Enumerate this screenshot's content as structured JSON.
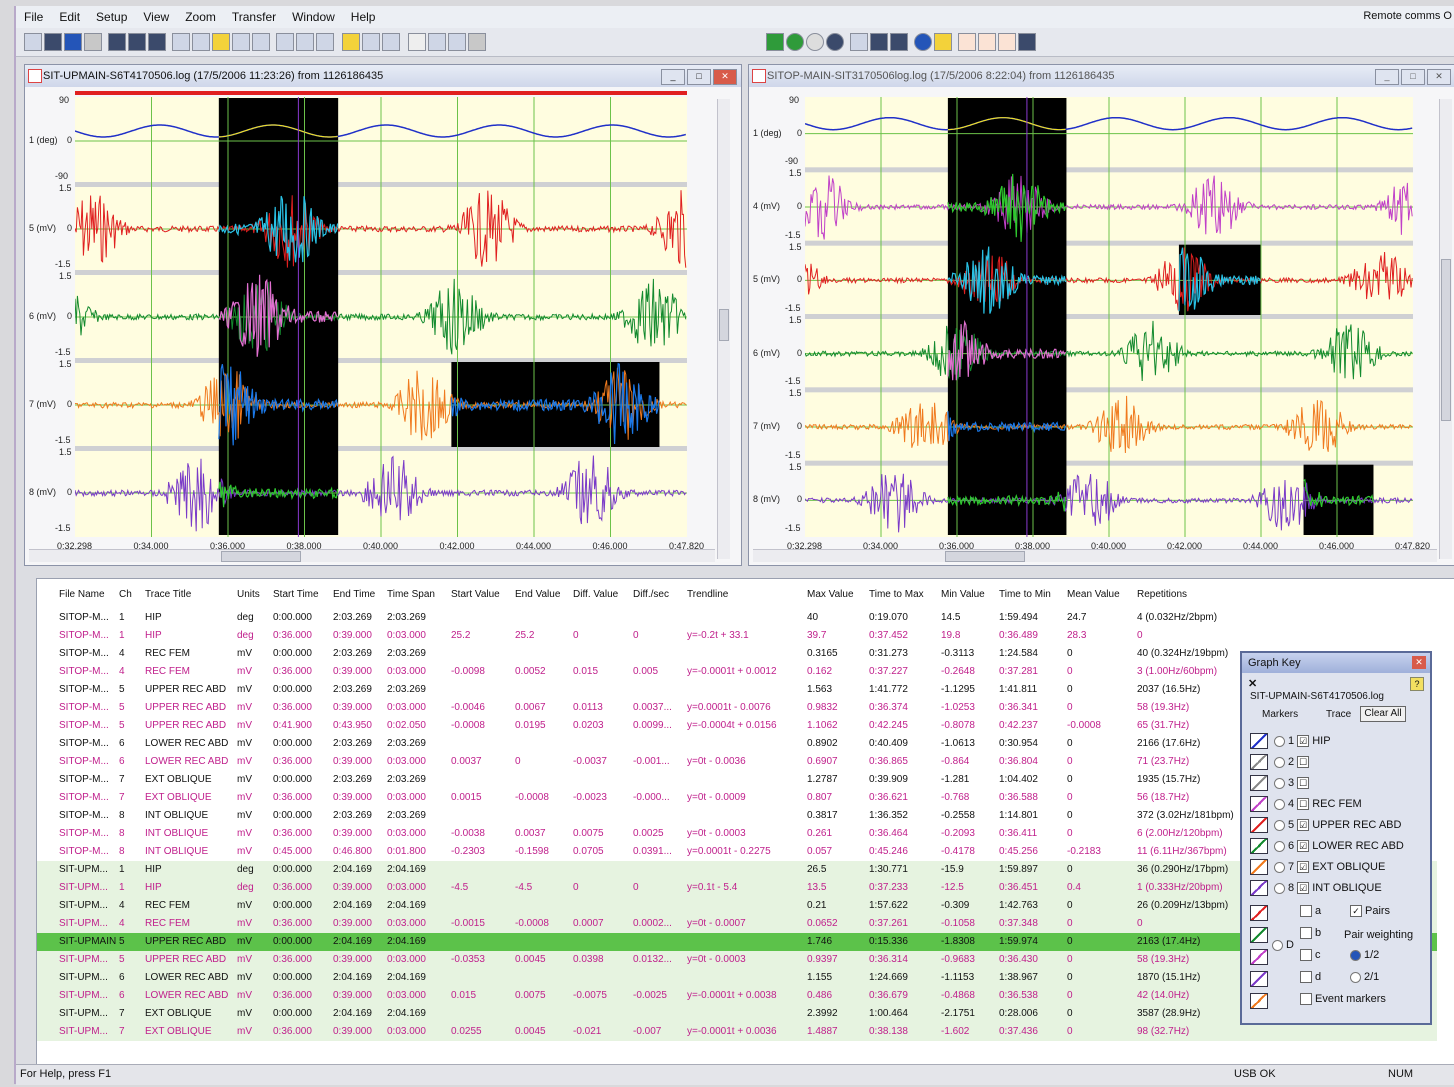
{
  "menu": {
    "items": [
      "File",
      "Edit",
      "Setup",
      "View",
      "Zoom",
      "Transfer",
      "Window",
      "Help"
    ],
    "remote_status": "Remote comms O"
  },
  "colors": {
    "trace1": "#2030c8",
    "trace5": "#e02020",
    "trace6": "#138a2e",
    "trace7": "#f07a1e",
    "trace8": "#7a3ac8",
    "trace4": "#c040c8",
    "highlight_cyan": "#29c2e6",
    "highlight_pink": "#e070d0",
    "highlight_blue": "#1a78e8",
    "highlight_green": "#2fc82f",
    "highlight_yellow": "#f0e020",
    "selected_row": "#5cc24a",
    "row_shade": "#e6f3e0",
    "magenta_text": "#c0208c"
  },
  "left_window": {
    "title": "SIT-UPMAIN-S6T4170506.log (17/5/2006 11:23:26) from 1126186435",
    "channels": [
      {
        "label": "1  (deg)",
        "top": "90",
        "zero": "0",
        "bottom": "-90"
      },
      {
        "label": "5  (mV)",
        "top": "1.5",
        "zero": "0",
        "bottom": "-1.5"
      },
      {
        "label": "6  (mV)",
        "top": "1.5",
        "zero": "0",
        "bottom": "-1.5"
      },
      {
        "label": "7  (mV)",
        "top": "1.5",
        "zero": "0",
        "bottom": "-1.5"
      },
      {
        "label": "8  (mV)",
        "top": "1.5",
        "zero": "0",
        "bottom": "-1.5"
      }
    ],
    "time_ticks": [
      "0:32.298",
      "0:34.000",
      "0:36.000",
      "0:38.000",
      "0:40.000",
      "0:42.000",
      "0:44.000",
      "0:46.000",
      "0:47.820"
    ]
  },
  "right_window": {
    "title": "SITOP-MAIN-SIT3170506log.log (17/5/2006 8:22:04) from 1126186435",
    "channels": [
      {
        "label": "1  (deg)",
        "top": "90",
        "zero": "0",
        "bottom": "-90"
      },
      {
        "label": "4  (mV)",
        "top": "1.5",
        "zero": "0",
        "bottom": "-1.5"
      },
      {
        "label": "5  (mV)",
        "top": "1.5",
        "zero": "0",
        "bottom": "-1.5"
      },
      {
        "label": "6  (mV)",
        "top": "1.5",
        "zero": "0",
        "bottom": "-1.5"
      },
      {
        "label": "7  (mV)",
        "top": "1.5",
        "zero": "0",
        "bottom": "-1.5"
      },
      {
        "label": "8  (mV)",
        "top": "1.5",
        "zero": "0",
        "bottom": "-1.5"
      }
    ],
    "time_ticks": [
      "0:32.298",
      "0:34.000",
      "0:36.000",
      "0:38.000",
      "0:40.000",
      "0:42.000",
      "0:44.000",
      "0:46.000",
      "0:47.820"
    ]
  },
  "table": {
    "headers": [
      "File Name",
      "Ch",
      "Trace Title",
      "Units",
      "Start Time",
      "End Time",
      "Time Span",
      "Start Value",
      "End Value",
      "Diff. Value",
      "Diff./sec",
      "Trendline",
      "Max Value",
      "Time to Max",
      "Min Value",
      "Time to Min",
      "Mean Value",
      "Repetitions"
    ],
    "rows": [
      {
        "style": "b",
        "c": [
          "SITOP-M...",
          "1",
          "HIP",
          "deg",
          "0:00.000",
          "2:03.269",
          "2:03.269",
          "",
          "",
          "",
          "",
          "",
          "40",
          "0:19.070",
          "14.5",
          "1:59.494",
          "24.7",
          "4 (0.032Hz/2bpm)"
        ]
      },
      {
        "style": "m",
        "c": [
          "SITOP-M...",
          "1",
          "HIP",
          "deg",
          "0:36.000",
          "0:39.000",
          "0:03.000",
          "25.2",
          "25.2",
          "0",
          "0",
          "y=-0.2t + 33.1",
          "39.7",
          "0:37.452",
          "19.8",
          "0:36.489",
          "28.3",
          "0"
        ]
      },
      {
        "style": "b",
        "c": [
          "SITOP-M...",
          "4",
          "REC FEM",
          "mV",
          "0:00.000",
          "2:03.269",
          "2:03.269",
          "",
          "",
          "",
          "",
          "",
          "0.3165",
          "0:31.273",
          "-0.3113",
          "1:24.584",
          "0",
          "40 (0.324Hz/19bpm)"
        ]
      },
      {
        "style": "m",
        "c": [
          "SITOP-M...",
          "4",
          "REC FEM",
          "mV",
          "0:36.000",
          "0:39.000",
          "0:03.000",
          "-0.0098",
          "0.0052",
          "0.015",
          "0.005",
          "y=-0.0001t + 0.0012",
          "0.162",
          "0:37.227",
          "-0.2648",
          "0:37.281",
          "0",
          "3 (1.00Hz/60bpm)"
        ]
      },
      {
        "style": "b",
        "c": [
          "SITOP-M...",
          "5",
          "UPPER REC ABD",
          "mV",
          "0:00.000",
          "2:03.269",
          "2:03.269",
          "",
          "",
          "",
          "",
          "",
          "1.563",
          "1:41.772",
          "-1.1295",
          "1:41.811",
          "0",
          "2037 (16.5Hz)"
        ]
      },
      {
        "style": "m",
        "c": [
          "SITOP-M...",
          "5",
          "UPPER REC ABD",
          "mV",
          "0:36.000",
          "0:39.000",
          "0:03.000",
          "-0.0046",
          "0.0067",
          "0.0113",
          "0.0037...",
          "y=0.0001t - 0.0076",
          "0.9832",
          "0:36.374",
          "-1.0253",
          "0:36.341",
          "0",
          "58 (19.3Hz)"
        ]
      },
      {
        "style": "m",
        "c": [
          "SITOP-M...",
          "5",
          "UPPER REC ABD",
          "mV",
          "0:41.900",
          "0:43.950",
          "0:02.050",
          "-0.0008",
          "0.0195",
          "0.0203",
          "0.0099...",
          "y=-0.0004t + 0.0156",
          "1.1062",
          "0:42.245",
          "-0.8078",
          "0:42.237",
          "-0.0008",
          "65 (31.7Hz)"
        ]
      },
      {
        "style": "b",
        "c": [
          "SITOP-M...",
          "6",
          "LOWER REC ABD",
          "mV",
          "0:00.000",
          "2:03.269",
          "2:03.269",
          "",
          "",
          "",
          "",
          "",
          "0.8902",
          "0:40.409",
          "-1.0613",
          "0:30.954",
          "0",
          "2166 (17.6Hz)"
        ]
      },
      {
        "style": "m",
        "c": [
          "SITOP-M...",
          "6",
          "LOWER REC ABD",
          "mV",
          "0:36.000",
          "0:39.000",
          "0:03.000",
          "0.0037",
          "0",
          "-0.0037",
          "-0.001...",
          "y=0t - 0.0036",
          "0.6907",
          "0:36.865",
          "-0.864",
          "0:36.804",
          "0",
          "71 (23.7Hz)"
        ]
      },
      {
        "style": "b",
        "c": [
          "SITOP-M...",
          "7",
          "EXT OBLIQUE",
          "mV",
          "0:00.000",
          "2:03.269",
          "2:03.269",
          "",
          "",
          "",
          "",
          "",
          "1.2787",
          "0:39.909",
          "-1.281",
          "1:04.402",
          "0",
          "1935 (15.7Hz)"
        ]
      },
      {
        "style": "m",
        "c": [
          "SITOP-M...",
          "7",
          "EXT OBLIQUE",
          "mV",
          "0:36.000",
          "0:39.000",
          "0:03.000",
          "0.0015",
          "-0.0008",
          "-0.0023",
          "-0.000...",
          "y=0t - 0.0009",
          "0.807",
          "0:36.621",
          "-0.768",
          "0:36.588",
          "0",
          "56 (18.7Hz)"
        ]
      },
      {
        "style": "b",
        "c": [
          "SITOP-M...",
          "8",
          "INT OBLIQUE",
          "mV",
          "0:00.000",
          "2:03.269",
          "2:03.269",
          "",
          "",
          "",
          "",
          "",
          "0.3817",
          "1:36.352",
          "-0.2558",
          "1:14.801",
          "0",
          "372 (3.02Hz/181bpm)"
        ]
      },
      {
        "style": "m",
        "c": [
          "SITOP-M...",
          "8",
          "INT OBLIQUE",
          "mV",
          "0:36.000",
          "0:39.000",
          "0:03.000",
          "-0.0038",
          "0.0037",
          "0.0075",
          "0.0025",
          "y=0t - 0.0003",
          "0.261",
          "0:36.464",
          "-0.2093",
          "0:36.411",
          "0",
          "6 (2.00Hz/120bpm)"
        ]
      },
      {
        "style": "m",
        "c": [
          "SITOP-M...",
          "8",
          "INT OBLIQUE",
          "mV",
          "0:45.000",
          "0:46.800",
          "0:01.800",
          "-0.2303",
          "-0.1598",
          "0.0705",
          "0.0391...",
          "y=0.0001t - 0.2275",
          "0.057",
          "0:45.246",
          "-0.4178",
          "0:45.256",
          "-0.2183",
          "11 (6.11Hz/367bpm)"
        ]
      },
      {
        "style": "gb",
        "c": [
          "SIT-UPM...",
          "1",
          "HIP",
          "deg",
          "0:00.000",
          "2:04.169",
          "2:04.169",
          "",
          "",
          "",
          "",
          "",
          "26.5",
          "1:30.771",
          "-15.9",
          "1:59.897",
          "0",
          "36 (0.290Hz/17bpm)"
        ]
      },
      {
        "style": "gm",
        "c": [
          "SIT-UPM...",
          "1",
          "HIP",
          "deg",
          "0:36.000",
          "0:39.000",
          "0:03.000",
          "-4.5",
          "-4.5",
          "0",
          "0",
          "y=0.1t - 5.4",
          "13.5",
          "0:37.233",
          "-12.5",
          "0:36.451",
          "0.4",
          "1 (0.333Hz/20bpm)"
        ]
      },
      {
        "style": "gb",
        "c": [
          "SIT-UPM...",
          "4",
          "REC FEM",
          "mV",
          "0:00.000",
          "2:04.169",
          "2:04.169",
          "",
          "",
          "",
          "",
          "",
          "0.21",
          "1:57.622",
          "-0.309",
          "1:42.763",
          "0",
          "26 (0.209Hz/13bpm)"
        ]
      },
      {
        "style": "gm",
        "c": [
          "SIT-UPM...",
          "4",
          "REC FEM",
          "mV",
          "0:36.000",
          "0:39.000",
          "0:03.000",
          "-0.0015",
          "-0.0008",
          "0.0007",
          "0.0002...",
          "y=0t - 0.0007",
          "0.0652",
          "0:37.261",
          "-0.1058",
          "0:37.348",
          "0",
          "0"
        ]
      },
      {
        "style": "sel",
        "c": [
          "SIT-UPMAIN",
          "5",
          "UPPER REC ABD",
          "mV",
          "0:00.000",
          "2:04.169",
          "2:04.169",
          "",
          "",
          "",
          "",
          "",
          "1.746",
          "0:15.336",
          "-1.8308",
          "1:59.974",
          "0",
          "2163 (17.4Hz)"
        ]
      },
      {
        "style": "gm",
        "c": [
          "SIT-UPM...",
          "5",
          "UPPER REC ABD",
          "mV",
          "0:36.000",
          "0:39.000",
          "0:03.000",
          "-0.0353",
          "0.0045",
          "0.0398",
          "0.0132...",
          "y=0t - 0.0003",
          "0.9397",
          "0:36.314",
          "-0.9683",
          "0:36.430",
          "0",
          "58 (19.3Hz)"
        ]
      },
      {
        "style": "gb",
        "c": [
          "SIT-UPM...",
          "6",
          "LOWER REC ABD",
          "mV",
          "0:00.000",
          "2:04.169",
          "2:04.169",
          "",
          "",
          "",
          "",
          "",
          "1.155",
          "1:24.669",
          "-1.1153",
          "1:38.967",
          "0",
          "1870 (15.1Hz)"
        ]
      },
      {
        "style": "gm",
        "c": [
          "SIT-UPM...",
          "6",
          "LOWER REC ABD",
          "mV",
          "0:36.000",
          "0:39.000",
          "0:03.000",
          "0.015",
          "0.0075",
          "-0.0075",
          "-0.0025",
          "y=-0.0001t + 0.0038",
          "0.486",
          "0:36.679",
          "-0.4868",
          "0:36.538",
          "0",
          "42 (14.0Hz)"
        ]
      },
      {
        "style": "gb",
        "c": [
          "SIT-UPM...",
          "7",
          "EXT OBLIQUE",
          "mV",
          "0:00.000",
          "2:04.169",
          "2:04.169",
          "",
          "",
          "",
          "",
          "",
          "2.3992",
          "1:00.464",
          "-2.1751",
          "0:28.006",
          "0",
          "3587 (28.9Hz)"
        ]
      },
      {
        "style": "gm",
        "c": [
          "SIT-UPM...",
          "7",
          "EXT OBLIQUE",
          "mV",
          "0:36.000",
          "0:39.000",
          "0:03.000",
          "0.0255",
          "0.0045",
          "-0.021",
          "-0.007",
          "y=-0.0001t + 0.0036",
          "1.4887",
          "0:38.138",
          "-1.602",
          "0:37.436",
          "0",
          "98 (32.7Hz)"
        ]
      }
    ]
  },
  "graph_key": {
    "title": "Graph Key",
    "file": "SIT-UPMAIN-S6T4170506.log",
    "markers_label": "Markers",
    "trace_label": "Trace",
    "clear_all": "Clear All",
    "traces": [
      {
        "num": "1",
        "name": "HIP",
        "checked": "☑"
      },
      {
        "num": "2",
        "name": "",
        "checked": "☐"
      },
      {
        "num": "3",
        "name": "",
        "checked": "☐"
      },
      {
        "num": "4",
        "name": "REC FEM",
        "checked": "☐"
      },
      {
        "num": "5",
        "name": "UPPER REC ABD",
        "checked": "☑"
      },
      {
        "num": "6",
        "name": "LOWER REC ABD",
        "checked": "☑"
      },
      {
        "num": "7",
        "name": "EXT OBLIQUE",
        "checked": "☑"
      },
      {
        "num": "8",
        "name": "INT OBLIQUE",
        "checked": "☑"
      }
    ],
    "marker_a": "a",
    "marker_b": "b",
    "marker_c": "c",
    "marker_d": "d",
    "marker_D": "D",
    "pairs": "Pairs",
    "pair_weighting": "Pair weighting",
    "w_half": "1/2",
    "w_two": "2/1",
    "event_markers": "Event markers"
  },
  "status": {
    "help": "For Help, press F1",
    "usb": "USB OK",
    "num": "NUM"
  }
}
